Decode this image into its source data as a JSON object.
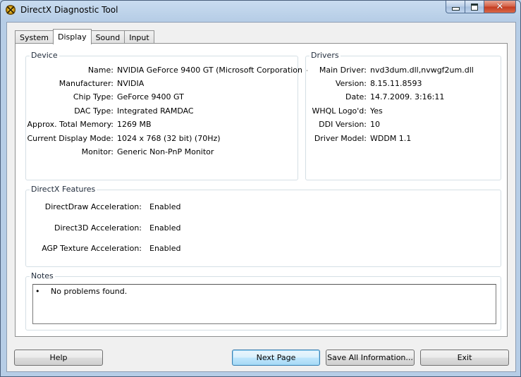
{
  "window": {
    "title": "DirectX Diagnostic Tool",
    "controls": {
      "minimize": "minimize",
      "maximize": "maximize",
      "close": "close"
    }
  },
  "tabs": [
    {
      "label": "System",
      "active": false
    },
    {
      "label": "Display",
      "active": true
    },
    {
      "label": "Sound",
      "active": false
    },
    {
      "label": "Input",
      "active": false
    }
  ],
  "device": {
    "title": "Device",
    "fields": [
      {
        "label": "Name:",
        "value": "NVIDIA GeForce 9400 GT (Microsoft Corporation -"
      },
      {
        "label": "Manufacturer:",
        "value": "NVIDIA"
      },
      {
        "label": "Chip Type:",
        "value": "GeForce 9400 GT"
      },
      {
        "label": "DAC Type:",
        "value": "Integrated RAMDAC"
      },
      {
        "label": "Approx. Total Memory:",
        "value": "1269 MB"
      },
      {
        "label": "Current Display Mode:",
        "value": "1024 x 768 (32 bit) (70Hz)"
      },
      {
        "label": "Monitor:",
        "value": "Generic Non-PnP Monitor"
      }
    ]
  },
  "drivers": {
    "title": "Drivers",
    "fields": [
      {
        "label": "Main Driver:",
        "value": "nvd3dum.dll,nvwgf2um.dll"
      },
      {
        "label": "Version:",
        "value": "8.15.11.8593"
      },
      {
        "label": "Date:",
        "value": "14.7.2009. 3:16:11"
      },
      {
        "label": "WHQL Logo'd:",
        "value": "Yes"
      },
      {
        "label": "DDI Version:",
        "value": "10"
      },
      {
        "label": "Driver Model:",
        "value": "WDDM 1.1"
      }
    ]
  },
  "features": {
    "title": "DirectX Features",
    "fields": [
      {
        "label": "DirectDraw Acceleration:",
        "value": "Enabled"
      },
      {
        "label": "Direct3D Acceleration:",
        "value": "Enabled"
      },
      {
        "label": "AGP Texture Acceleration:",
        "value": "Enabled"
      }
    ]
  },
  "notes": {
    "title": "Notes",
    "bullet": "•",
    "items": [
      "No problems found."
    ]
  },
  "buttons": {
    "help": "Help",
    "next_page": "Next Page",
    "save_all": "Save All Information...",
    "exit": "Exit"
  },
  "colors": {
    "accent": "#3c7fb1",
    "window_frame": "#b6cde6",
    "close_button": "#c23a1f"
  }
}
